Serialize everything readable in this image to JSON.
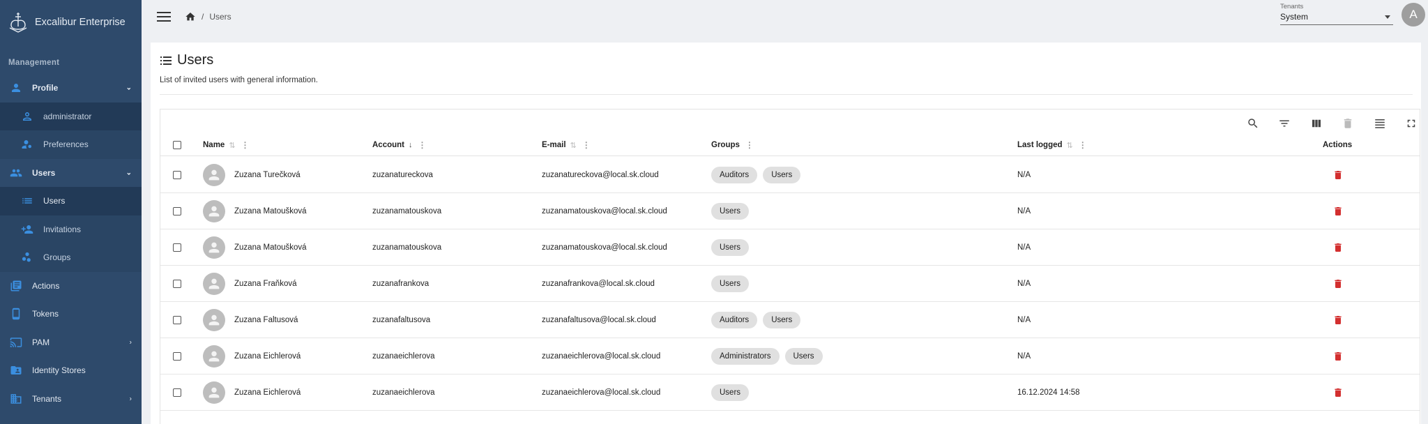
{
  "app": {
    "title": "Excalibur Enterprise"
  },
  "sidebar": {
    "section": "Management",
    "items": [
      {
        "label": "Profile",
        "icon": "person-icon",
        "expanded": true
      },
      {
        "label": "administrator",
        "icon": "person-outline-icon"
      },
      {
        "label": "Preferences",
        "icon": "person-settings-icon"
      },
      {
        "label": "Users",
        "icon": "people-icon",
        "expanded": true
      },
      {
        "label": "Users",
        "icon": "list-icon"
      },
      {
        "label": "Invitations",
        "icon": "person-add-icon"
      },
      {
        "label": "Groups",
        "icon": "groups-icon"
      },
      {
        "label": "Actions",
        "icon": "actions-icon"
      },
      {
        "label": "Tokens",
        "icon": "phone-icon"
      },
      {
        "label": "PAM",
        "icon": "cast-icon"
      },
      {
        "label": "Identity Stores",
        "icon": "folder-person-icon"
      },
      {
        "label": "Tenants",
        "icon": "building-icon"
      }
    ]
  },
  "breadcrumb": {
    "current": "Users"
  },
  "tenant": {
    "label": "Tenants",
    "value": "System"
  },
  "user": {
    "initial": "A"
  },
  "page": {
    "title": "Users",
    "subtitle": "List of invited users with general information."
  },
  "table": {
    "columns": {
      "name": "Name",
      "account": "Account",
      "email": "E-mail",
      "groups": "Groups",
      "last_logged": "Last logged",
      "actions": "Actions"
    },
    "rows": [
      {
        "name": "Zuzana Turečková",
        "account": "zuzanatureckova",
        "email": "zuzanatureckova@local.sk.cloud",
        "groups": [
          "Auditors",
          "Users"
        ],
        "last_logged": "N/A"
      },
      {
        "name": "Zuzana Matoušková",
        "account": "zuzanamatouskova",
        "email": "zuzanamatouskova@local.sk.cloud",
        "groups": [
          "Users"
        ],
        "last_logged": "N/A"
      },
      {
        "name": "Zuzana Matoušková",
        "account": "zuzanamatouskova",
        "email": "zuzanamatouskova@local.sk.cloud",
        "groups": [
          "Users"
        ],
        "last_logged": "N/A"
      },
      {
        "name": "Zuzana Fraňková",
        "account": "zuzanafrankova",
        "email": "zuzanafrankova@local.sk.cloud",
        "groups": [
          "Users"
        ],
        "last_logged": "N/A"
      },
      {
        "name": "Zuzana Faltusová",
        "account": "zuzanafaltusova",
        "email": "zuzanafaltusova@local.sk.cloud",
        "groups": [
          "Auditors",
          "Users"
        ],
        "last_logged": "N/A"
      },
      {
        "name": "Zuzana Eichlerová",
        "account": "zuzanaeichlerova",
        "email": "zuzanaeichlerova@local.sk.cloud",
        "groups": [
          "Administrators",
          "Users"
        ],
        "last_logged": "N/A"
      },
      {
        "name": "Zuzana Eichlerová",
        "account": "zuzanaeichlerova",
        "email": "zuzanaeichlerova@local.sk.cloud",
        "groups": [
          "Users"
        ],
        "last_logged": "16.12.2024 14:58"
      }
    ]
  },
  "colors": {
    "sidebar": "#2e4a6b",
    "accent": "#3b8fe0",
    "delete": "#d32f2f"
  }
}
